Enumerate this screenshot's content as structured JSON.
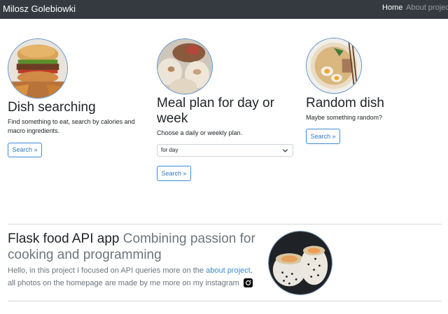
{
  "navbar": {
    "brand": "Milosz Golebiowki",
    "links": [
      {
        "label": "Home",
        "active": true
      },
      {
        "label": "About project",
        "active": false
      }
    ]
  },
  "cards": [
    {
      "title": "Dish searching",
      "text": "Find something to eat, search by calories and macro ingredients.",
      "button": "Search »",
      "image_icon": "burger-photo"
    },
    {
      "title": "Meal plan for day or week",
      "text": "Choose a daily or weekly plan.",
      "select": {
        "value": "for day"
      },
      "button": "Search »",
      "image_icon": "dumplings-photo"
    },
    {
      "title": "Random dish",
      "text": "Maybe something random?",
      "button": "Search »",
      "image_icon": "ramen-photo"
    }
  ],
  "feature": {
    "title_main": "Flask food API app",
    "title_muted": "Combining passion for cooking and programming",
    "lead_before": "Hello, in this project I focused on API queries more on the ",
    "lead_link": "about project",
    "lead_after": ", all photos on the homepage are made by me more on my instagram",
    "instagram_icon": "instagram-icon",
    "image_icon": "sushi-photo"
  },
  "colors": {
    "navbar_bg": "#343a40",
    "accent": "#3d8bd4",
    "muted_text": "#6c757d"
  }
}
